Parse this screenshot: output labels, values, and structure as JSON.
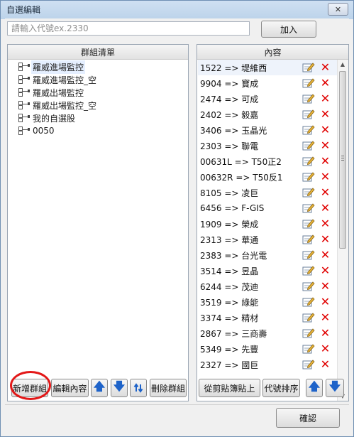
{
  "window": {
    "title": "自選編輯",
    "close_label": "✕"
  },
  "search": {
    "placeholder": "請輸入代號ex.2330",
    "value": ""
  },
  "buttons": {
    "add": "加入",
    "new_group": "新增群組",
    "edit_content": "編輯內容",
    "delete_group": "刪除群組",
    "paste": "從剪貼簿貼上",
    "sort": "代號排序",
    "ok": "確認"
  },
  "groups": {
    "header": "群組清單",
    "items": [
      {
        "label": "羅威進場監控",
        "selected": true
      },
      {
        "label": "羅威進場監控_空",
        "selected": false
      },
      {
        "label": "羅威出場監控",
        "selected": false
      },
      {
        "label": "羅威出場監控_空",
        "selected": false
      },
      {
        "label": "我的自選股",
        "selected": false
      },
      {
        "label": "0050",
        "selected": false
      }
    ]
  },
  "content": {
    "header": "內容",
    "items": [
      "1522 => 堤維西",
      "9904 => 寶成",
      "2474 => 可成",
      "2402 => 毅嘉",
      "3406 => 玉晶光",
      "2303 => 聯電",
      "00631L => T50正2",
      "00632R => T50反1",
      "8105 => 凌巨",
      "6456 => F-GIS",
      "1909 => 榮成",
      "2313 => 華通",
      "2383 => 台光電",
      "3514 => 昱晶",
      "6244 => 茂迪",
      "3519 => 綠能",
      "3374 => 精材",
      "2867 => 三商壽",
      "5349 => 先豐",
      "2327 => 國巨"
    ]
  },
  "colors": {
    "delete": "#e00000",
    "arrow": "#1e63c9",
    "highlight": "#e31818"
  }
}
